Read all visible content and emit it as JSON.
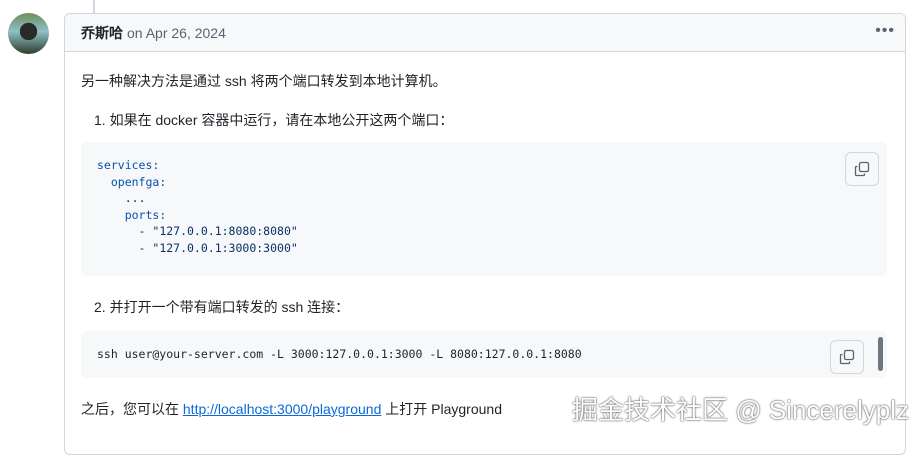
{
  "comment": {
    "author": "乔斯哈",
    "date": "on Apr 26, 2024",
    "intro": "另一种解决方法是通过 ssh 将两个端口转发到本地计算机。",
    "step1": "1. 如果在 docker 容器中运行，请在本地公开这两个端口：",
    "code1": {
      "line1": "services:",
      "line2": "openfga:",
      "line3": "...",
      "line4": "ports:",
      "line5": "\"127.0.0.1:8080:8080\"",
      "line6": "\"127.0.0.1:3000:3000\""
    },
    "step2": "2. 并打开一个带有端口转发的 ssh 连接：",
    "code2": "ssh user@your-server.com -L 3000:127.0.0.1:3000 -L 8080:127.0.0.1:8080",
    "outro_prefix": "之后，您可以在 ",
    "link": "http://localhost:3000/playground",
    "outro_suffix": " 上打开 Playground"
  },
  "watermark": "掘金技术社区 @ Sincerelyplz"
}
